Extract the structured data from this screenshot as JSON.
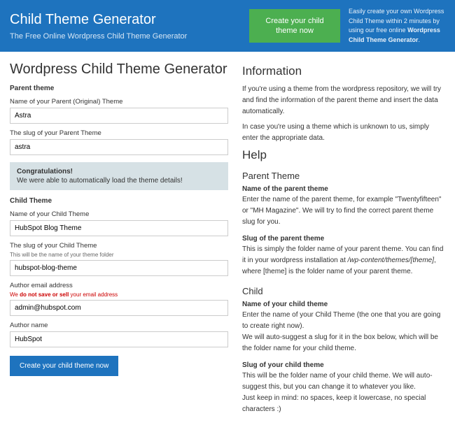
{
  "header": {
    "title": "Child Theme Generator",
    "subtitle": "The Free Online Wordpress Child Theme Generator",
    "cta": "Create your child theme now",
    "desc_pre": "Easily create your own Wordpress Child Theme within 2 minutes by using our free online ",
    "desc_bold": "Wordpress Child Theme Generator",
    "desc_post": "."
  },
  "main_heading": "Wordpress Child Theme Generator",
  "form": {
    "parent_section": "Parent theme",
    "parent_name_label": "Name of your Parent (Original) Theme",
    "parent_name_value": "Astra",
    "parent_slug_label": "The slug of your Parent Theme",
    "parent_slug_value": "astra",
    "alert_title": "Congratulations!",
    "alert_text": "We were able to automatically load the theme details!",
    "child_section": "Child Theme",
    "child_name_label": "Name of your Child Theme",
    "child_name_value": "HubSpot Blog Theme",
    "child_slug_label": "The slug of your Child Theme",
    "child_slug_hint": "This will be the name of your theme folder",
    "child_slug_value": "hubspot-blog-theme",
    "author_email_label": "Author email address",
    "author_email_hint": "We do not save or sell your email address",
    "author_email_value": "admin@hubspot.com",
    "author_name_label": "Author name",
    "author_name_value": "HubSpot",
    "submit": "Create your child theme now"
  },
  "info": {
    "heading": "Information",
    "p1": "If you're using a theme from the wordpress repository, we will try and find the information of the parent theme and insert the data automatically.",
    "p2": "In case you're using a theme which is unknown to us, simply enter the appropriate data."
  },
  "help": {
    "heading": "Help",
    "parent_heading": "Parent Theme",
    "parent_name_t": "Name of the parent theme",
    "parent_name_b": "Enter the name of the parent theme, for example \"Twentyfifteen\" or \"MH Magazine\". We will try to find the correct parent theme slug for you.",
    "parent_slug_t": "Slug of the parent theme",
    "parent_slug_b1": "This is simply the folder name of your parent theme. You can find it in your wordpress installation at ",
    "parent_slug_path": "/wp-content/themes/[theme]",
    "parent_slug_b2": ", where [theme] is the folder name of your parent theme.",
    "child_heading": "Child",
    "child_name_t": "Name of your child theme",
    "child_name_b": "Enter the name of your Child Theme (the one that you are going to create right now).\nWe will auto-suggest a slug for it in the box below, which will be the folder name for your child theme.",
    "child_slug_t": "Slug of your child theme",
    "child_slug_b": "This will be the folder name of your child theme. We will auto-suggest this, but you can change it to whatever you like.\nJust keep in mind: no spaces, keep it lowercase, no special characters :)"
  }
}
